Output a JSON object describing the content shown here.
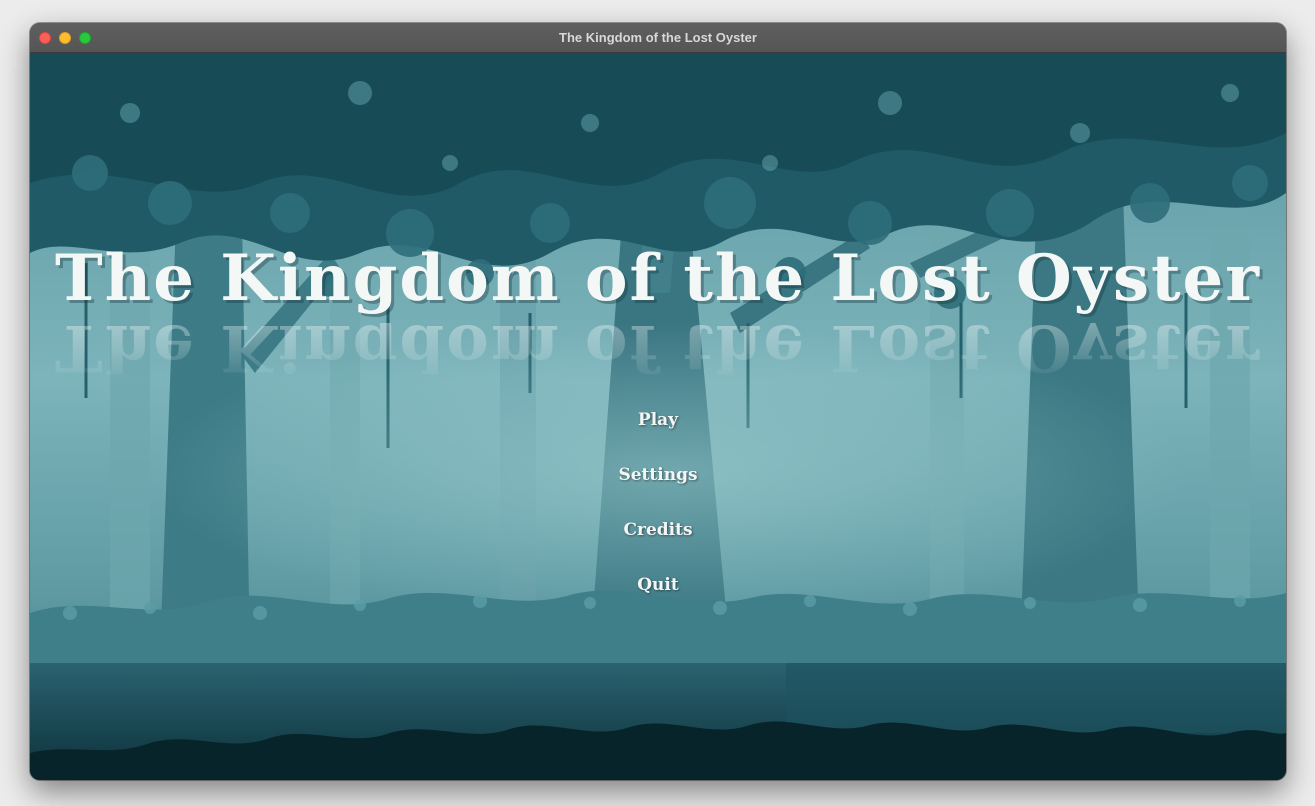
{
  "window": {
    "title": "The Kingdom of the Lost Oyster"
  },
  "game": {
    "title": "The Kingdom of the Lost Oyster",
    "menu": [
      {
        "label": "Play"
      },
      {
        "label": "Settings"
      },
      {
        "label": "Credits"
      },
      {
        "label": "Quit"
      }
    ]
  },
  "colors": {
    "sky_fog": "#6fa8b0",
    "mid_trees": "#3c7a85",
    "dark_foliage": "#1e5561",
    "ground_dark": "#0b2e36",
    "text": "#f3f7f6"
  }
}
